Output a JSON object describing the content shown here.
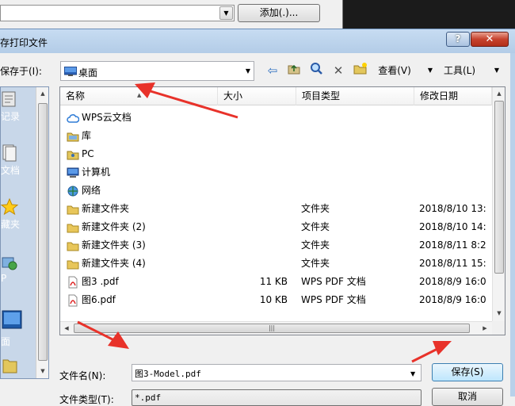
{
  "background": {
    "add_button": "添加(.)..."
  },
  "dialog": {
    "title": "存打印文件",
    "help_glyph": "?",
    "close_glyph": "✕"
  },
  "toolbar": {
    "save_in_label": "保存于(I):",
    "save_in_value": "桌面",
    "views_label": "查看(V)",
    "tools_label": "工具(L)"
  },
  "places": [
    {
      "label": "记录",
      "icon": "recent-icon"
    },
    {
      "label": "文档",
      "icon": "documents-icon"
    },
    {
      "label": "藏夹",
      "icon": "favorites-icon"
    },
    {
      "label": "P",
      "icon": "network-place-icon"
    },
    {
      "label": "面",
      "icon": "desktop-icon"
    }
  ],
  "columns": {
    "name": "名称",
    "size": "大小",
    "type": "项目类型",
    "date": "修改日期"
  },
  "files": [
    {
      "name": "WPS云文档",
      "size": "",
      "type": "",
      "date": "",
      "icon": "cloud-icon"
    },
    {
      "name": "库",
      "size": "",
      "type": "",
      "date": "",
      "icon": "library-icon"
    },
    {
      "name": "PC",
      "size": "",
      "type": "",
      "date": "",
      "icon": "user-folder-icon"
    },
    {
      "name": "计算机",
      "size": "",
      "type": "",
      "date": "",
      "icon": "computer-icon"
    },
    {
      "name": "网络",
      "size": "",
      "type": "",
      "date": "",
      "icon": "network-icon"
    },
    {
      "name": "新建文件夹",
      "size": "",
      "type": "文件夹",
      "date": "2018/8/10 13:",
      "icon": "folder-icon"
    },
    {
      "name": "新建文件夹 (2)",
      "size": "",
      "type": "文件夹",
      "date": "2018/8/10 14:",
      "icon": "folder-icon"
    },
    {
      "name": "新建文件夹 (3)",
      "size": "",
      "type": "文件夹",
      "date": "2018/8/11 8:2",
      "icon": "folder-icon"
    },
    {
      "name": "新建文件夹 (4)",
      "size": "",
      "type": "文件夹",
      "date": "2018/8/11 15:",
      "icon": "folder-icon"
    },
    {
      "name": "图3 .pdf",
      "size": "11 KB",
      "type": "WPS PDF 文档",
      "date": "2018/8/9 16:0",
      "icon": "pdf-file-icon"
    },
    {
      "name": "图6.pdf",
      "size": "10 KB",
      "type": "WPS PDF 文档",
      "date": "2018/8/9 16:0",
      "icon": "pdf-file-icon"
    }
  ],
  "form": {
    "filename_label": "文件名(N):",
    "filename_value": "图3-Model.pdf",
    "filetype_label": "文件类型(T):",
    "filetype_value": "*.pdf",
    "save_button": "保存(S)",
    "cancel_button": "取消"
  },
  "colors": {
    "annotation_red": "#e8322a",
    "title_bar": "#b9d1ea",
    "selection_border": "#3c7fb1"
  }
}
